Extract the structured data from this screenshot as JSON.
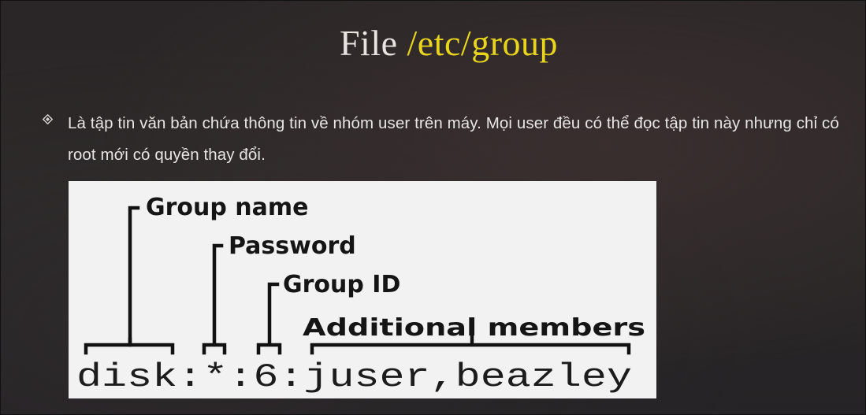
{
  "slide": {
    "title_prefix": "File ",
    "title_path": "/etc/group",
    "bullet_icon": "diamond-bullet-icon",
    "bullet_text": "Là tập tin văn bản chứa thông tin về nhóm user trên máy. Mọi user đều có thể đọc tập tin này nhưng chỉ có root mới có quyền thay đổi."
  },
  "figure": {
    "labels": {
      "group_name": "Group name",
      "password": "Password",
      "group_id": "Group ID",
      "additional_members": "Additional members"
    },
    "example_line": "disk:*:6:juser,beazley"
  }
}
